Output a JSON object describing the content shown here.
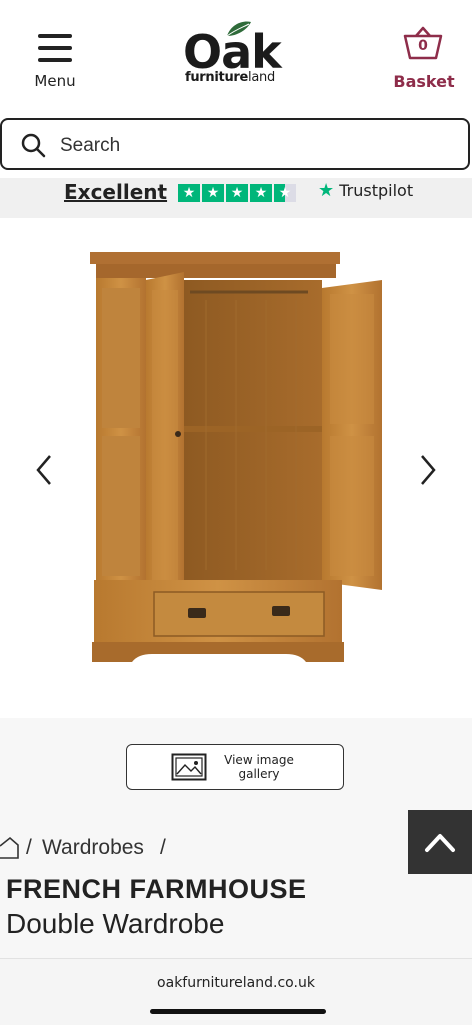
{
  "header": {
    "menu_label": "Menu",
    "logo_main": "Oak",
    "logo_sub_bold": "furniture",
    "logo_sub_thin": "land",
    "basket_count": "0",
    "basket_label": "Basket"
  },
  "search": {
    "placeholder": "Search"
  },
  "trustpilot": {
    "rating_text": "Excellent",
    "brand": "Trustpilot",
    "stars": 4.5
  },
  "gallery": {
    "button_label": "View image gallery"
  },
  "breadcrumb": {
    "separator": "/",
    "category": "Wardrobes"
  },
  "product": {
    "range": "FRENCH FARMHOUSE",
    "name": "Double Wardrobe"
  },
  "browser": {
    "url": "oakfurnitureland.co.uk"
  },
  "colors": {
    "brand_accent": "#8e2d4a",
    "trustpilot_green": "#00b67a",
    "back_to_top_bg": "#333333"
  }
}
